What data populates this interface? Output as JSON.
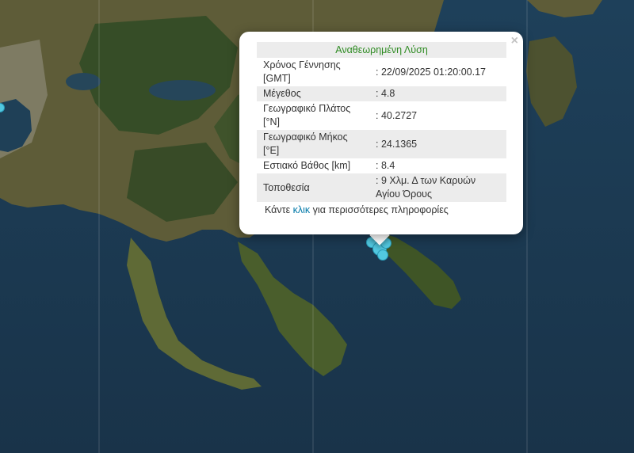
{
  "popup": {
    "title": "Αναθεωρημένη Λύση",
    "close_label": "×",
    "rows": [
      {
        "label": "Χρόνος Γέννησης [GMT]",
        "value": ": 22/09/2025 01:20:00.17"
      },
      {
        "label": "Μέγεθος",
        "value": ": 4.8"
      },
      {
        "label": "Γεωγραφικό Πλάτος [°N]",
        "value": ": 40.2727"
      },
      {
        "label": "Γεωγραφικό Μήκος [°E]",
        "value": ": 24.1365"
      },
      {
        "label": "Εστιακό Βάθος [km]",
        "value": ": 8.4"
      },
      {
        "label": "Τοποθεσία",
        "value": ": 9 Χλμ. Δ των Καρυών Αγίου Όρους"
      }
    ],
    "more_prefix": "Κάντε ",
    "more_link": "κλικ",
    "more_suffix": " για περισσότερες πληροφορίες"
  },
  "colors": {
    "sea": "#1c3b54",
    "land": "#5b5a35",
    "forest": "#2f4a25",
    "marker": "#52c8e0",
    "title_green": "#2e8b22",
    "link": "#0078a8"
  }
}
